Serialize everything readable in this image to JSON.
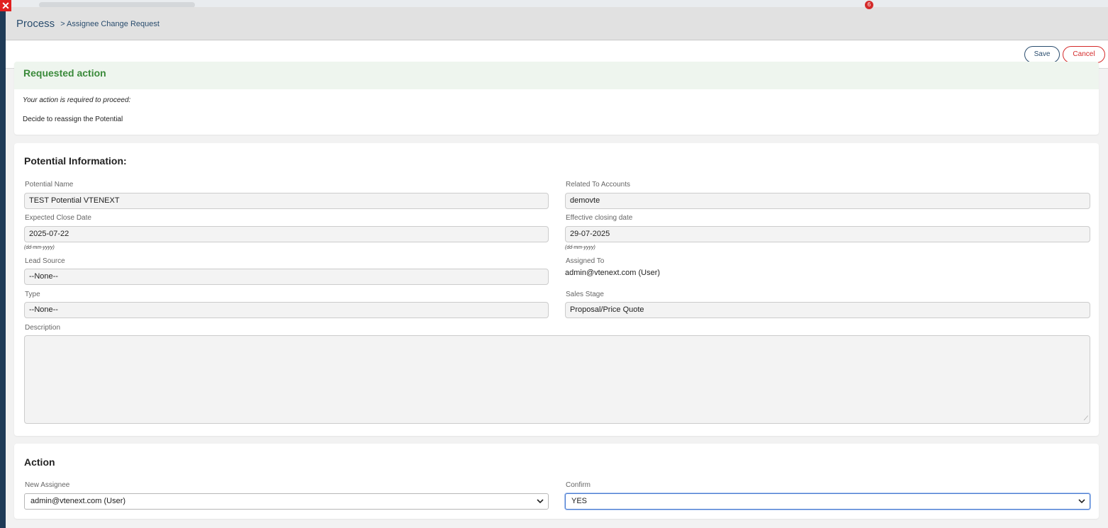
{
  "window": {
    "close_glyph": "✕",
    "notification_count": "6"
  },
  "header": {
    "title": "Process",
    "breadcrumb": "> Assignee Change Request"
  },
  "toolbar": {
    "save_label": "Save",
    "cancel_label": "Cancel"
  },
  "requested_action": {
    "heading": "Requested action",
    "subtitle": "Your action is required to proceed:",
    "message": "Decide to reassign the Potential"
  },
  "potential": {
    "heading": "Potential Information:",
    "fields": {
      "potential_name": {
        "label": "Potential Name",
        "value": "TEST Potential VTENEXT"
      },
      "related_to": {
        "label": "Related To Accounts",
        "value": "demovte"
      },
      "expected_close_date": {
        "label": "Expected Close Date",
        "value": "2025-07-22",
        "hint": "(dd-mm-yyyy)"
      },
      "effective_closing_date": {
        "label": "Effective closing date",
        "value": "29-07-2025",
        "hint": "(dd-mm-yyyy)"
      },
      "lead_source": {
        "label": "Lead Source",
        "value": "--None--"
      },
      "assigned_to": {
        "label": "Assigned To",
        "value": "admin@vtenext.com (User)"
      },
      "type": {
        "label": "Type",
        "value": "--None--"
      },
      "sales_stage": {
        "label": "Sales Stage",
        "value": "Proposal/Price Quote"
      },
      "description": {
        "label": "Description",
        "value": ""
      }
    }
  },
  "action": {
    "heading": "Action",
    "new_assignee": {
      "label": "New Assignee",
      "selected": "admin@vtenext.com (User)"
    },
    "confirm": {
      "label": "Confirm",
      "selected": "YES"
    }
  },
  "colors": {
    "brand": "#2a4d6e",
    "cancel": "#d42a2a",
    "success": "#3a8a3a",
    "focus": "#4a7bd0"
  }
}
